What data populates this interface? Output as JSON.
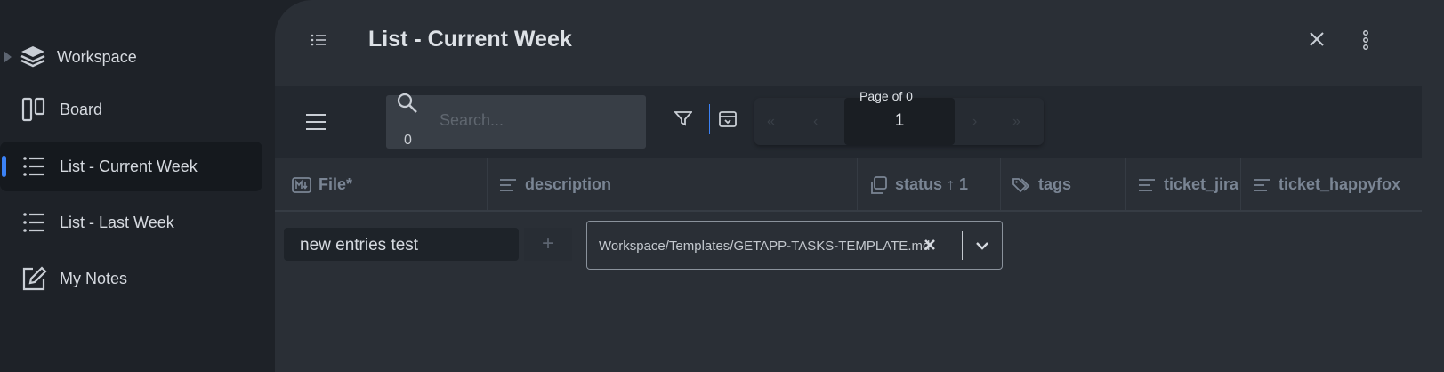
{
  "sidebar": {
    "items": [
      {
        "label": "Workspace",
        "icon": "layers-icon"
      },
      {
        "label": "Board",
        "icon": "board-icon"
      },
      {
        "label": "List - Current Week",
        "icon": "list-icon",
        "active": true
      },
      {
        "label": "List - Last Week",
        "icon": "list-icon"
      },
      {
        "label": "My Notes",
        "icon": "edit-icon"
      }
    ]
  },
  "header": {
    "title": "List - Current Week"
  },
  "toolbar": {
    "search_placeholder": "Search...",
    "search_count": "0",
    "page_label": "Page of 0",
    "page_value": "1"
  },
  "columns": [
    {
      "label": "File*",
      "icon": "markdown-icon"
    },
    {
      "label": "description",
      "icon": "text-lines-icon"
    },
    {
      "label": "status ↑ 1",
      "icon": "copy-icon"
    },
    {
      "label": "tags",
      "icon": "tags-icon"
    },
    {
      "label": "ticket_jira",
      "icon": "text-lines-icon"
    },
    {
      "label": "ticket_happyfox",
      "icon": "text-lines-icon"
    }
  ],
  "new_row": {
    "entry_value": "new entries test",
    "add_label": "+",
    "template_value": "Workspace/Templates/GETAPP-TASKS-TEMPLATE.md"
  },
  "colors": {
    "accent": "#3b82f6",
    "sidebar_bg": "#1e2228",
    "panel_bg": "#2a2f36"
  }
}
